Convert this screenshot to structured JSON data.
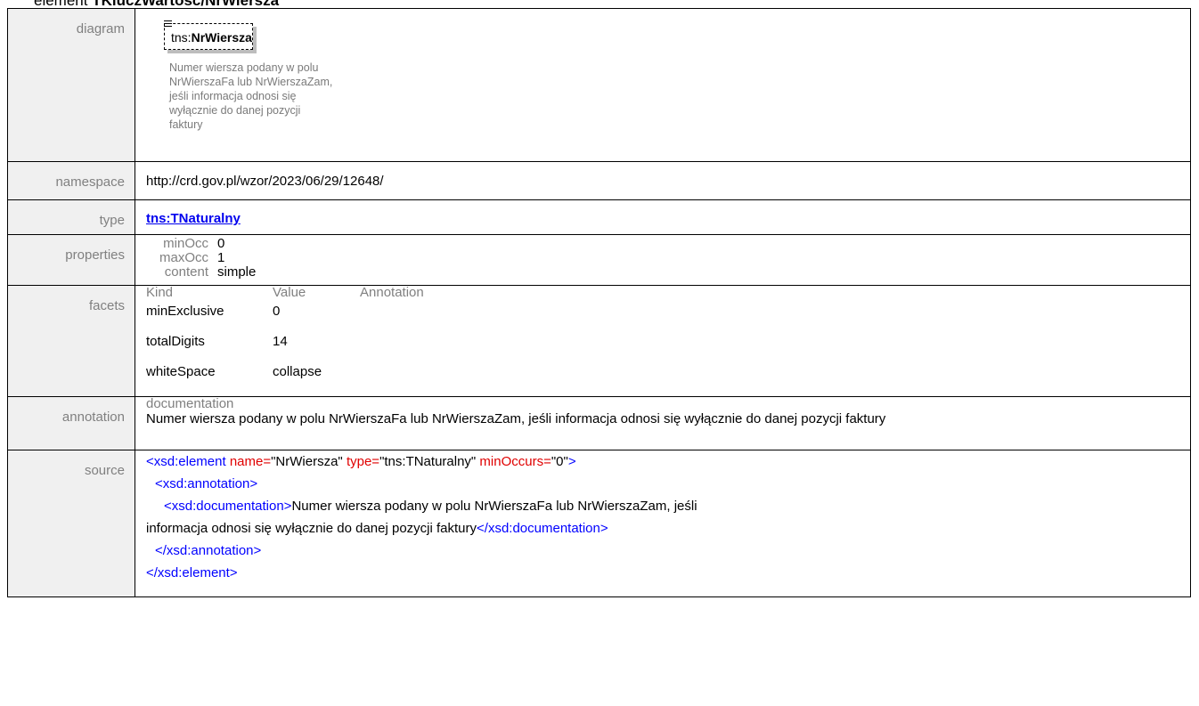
{
  "heading": {
    "prefix": "element",
    "name": "TKluczWartosc/NrWiersza"
  },
  "rows": {
    "diagram": "diagram",
    "namespace": "namespace",
    "type": "type",
    "properties": "properties",
    "facets": "facets",
    "annotation": "annotation",
    "source": "source"
  },
  "diagram": {
    "ns_prefix": "tns:",
    "element_name": "NrWiersza",
    "note_lines": [
      "Numer wiersza podany w polu",
      "NrWierszaFa lub NrWierszaZam,",
      "jeśli informacja odnosi się",
      "wyłącznie do danej pozycji",
      "faktury"
    ]
  },
  "namespace_value": "http://crd.gov.pl/wzor/2023/06/29/12648/",
  "type_value": "tns:TNaturalny",
  "properties": [
    {
      "key": "minOcc",
      "value": "0"
    },
    {
      "key": "maxOcc",
      "value": "1"
    },
    {
      "key": "content",
      "value": "simple"
    }
  ],
  "facets": {
    "headers": [
      "Kind",
      "Value",
      "Annotation"
    ],
    "rows": [
      {
        "kind": "minExclusive",
        "value": "0"
      },
      {
        "kind": "totalDigits",
        "value": "14"
      },
      {
        "kind": "whiteSpace",
        "value": "collapse"
      }
    ]
  },
  "annotation": {
    "label": "documentation",
    "text": "Numer wiersza podany w polu NrWierszaFa lub NrWierszaZam, jeśli informacja odnosi się wyłącznie do danej pozycji faktury"
  },
  "source": {
    "line1_tag": "<xsd:element",
    "attr_name": "name=",
    "attr_name_val": "\"NrWiersza\"",
    "attr_type": "type=",
    "attr_type_val": "\"tns:TNaturalny\"",
    "attr_min": "minOccurs=",
    "attr_min_val": "\"0\"",
    "close": ">",
    "ann_open": "<xsd:annotation>",
    "doc_open": "<xsd:documentation>",
    "doc_text_1": "Numer wiersza podany w polu NrWierszaFa lub NrWierszaZam, jeśli",
    "doc_text_2": "informacja odnosi się wyłącznie do danej pozycji faktury",
    "doc_close": "</xsd:documentation>",
    "ann_close": "</xsd:annotation>",
    "elem_close": "</xsd:element>"
  }
}
